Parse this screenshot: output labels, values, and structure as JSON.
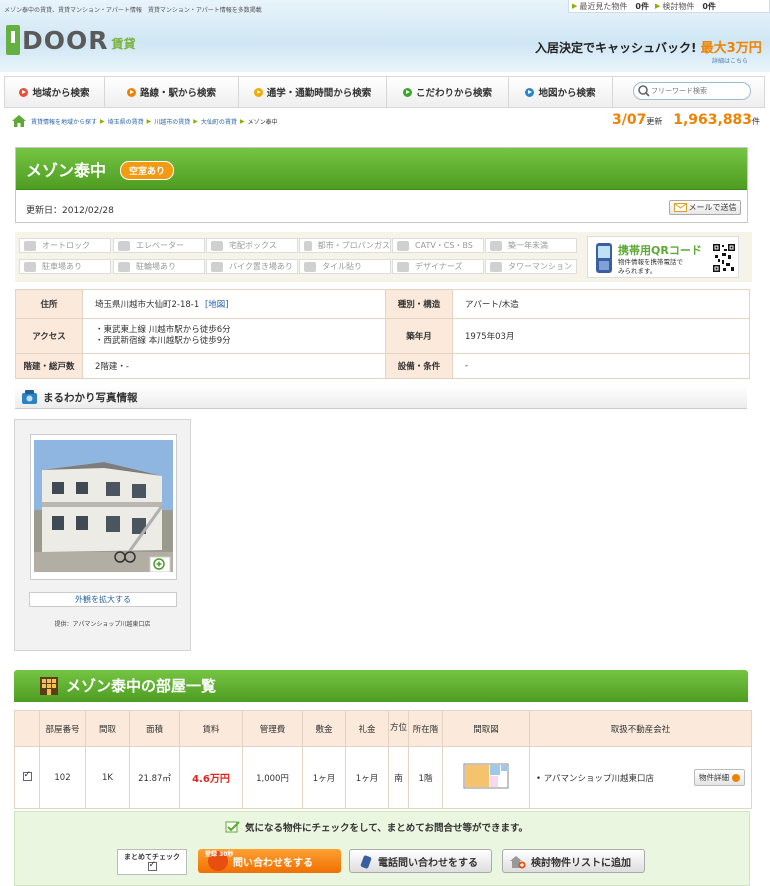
{
  "header": {
    "tagline": "メゾン泰中の賃貸、賃貸マンション・アパート情報　賃貸マンション・アパート情報を多数掲載",
    "recently_viewed_label": "最近見た物件",
    "recently_viewed_count": "0件",
    "considering_label": "検討物件",
    "considering_count": "0件",
    "logo_text": "DOOR",
    "logo_sub": "賃貸",
    "cashback_text": "入居決定でキャッシュバック!",
    "cashback_max": "最大3万円",
    "details_link": "詳細はこちら"
  },
  "nav": {
    "items": [
      {
        "label": "地域から検索",
        "color": "#e84e3a"
      },
      {
        "label": "路線・駅から検索",
        "color": "#ef8200"
      },
      {
        "label": "通学・通勤時間から検索",
        "color": "#f2a900"
      },
      {
        "label": "こだわりから検索",
        "color": "#3aa62a"
      },
      {
        "label": "地図から検索",
        "color": "#2a86c8"
      }
    ],
    "search_placeholder": "フリーワード検索"
  },
  "breadcrumb": [
    "賃貸情報を地域から探す",
    "埼玉県の賃貸",
    "川越市の賃貸",
    "大仙町の賃貸",
    "メゾン泰中"
  ],
  "update": {
    "date": "3/07",
    "date_suffix": "更新",
    "count": "1,963,883",
    "count_suffix": "件"
  },
  "property": {
    "name": "メゾン泰中",
    "vacancy": "空室あり",
    "updated": "更新日：2012/02/28",
    "mail_button": "メールで送信"
  },
  "features": [
    "オートロック",
    "エレベーター",
    "宅配ボックス",
    "都市・プロパンガス",
    "CATV・CS・BS",
    "築一年未満",
    "駐車場あり",
    "駐輪場あり",
    "バイク置き場あり",
    "タイル貼り",
    "デザイナーズ",
    "タワーマンション"
  ],
  "qr": {
    "title": "携帯用QRコード",
    "desc": "物件情報を携帯電話で\nみられます。"
  },
  "details": {
    "address_label": "住所",
    "address": "埼玉県川越市大仙町2-18-1",
    "map_link": "[地図]",
    "type_label": "種別・構造",
    "type": "アパート/木造",
    "access_label": "アクセス",
    "access_1": "・東武東上線 川越市駅から徒歩6分",
    "access_2": "・西武新宿線 本川越駅から徒歩9分",
    "built_label": "築年月",
    "built": "1975年03月",
    "floors_label": "階建・総戸数",
    "floors": "2階建・-",
    "facilities_label": "設備・条件",
    "facilities": "-"
  },
  "photo": {
    "title": "まるわかり写真情報",
    "enlarge": "外観を拡大する",
    "provider": "提供：アパマンショップ川越東口店"
  },
  "rooms": {
    "title": "メゾン泰中の部屋一覧",
    "headers": [
      "部屋番号",
      "間取",
      "面積",
      "賃料",
      "管理費",
      "敷金",
      "礼金",
      "方位",
      "所在階",
      "間取図",
      "取扱不動産会社"
    ],
    "row": {
      "room": "102",
      "layout": "1K",
      "area": "21.87㎡",
      "rent": "4.6万円",
      "fee": "1,000円",
      "deposit": "1ヶ月",
      "key": "1ヶ月",
      "direction": "南",
      "floor": "1階",
      "agent": "アパマンショップ川越東口店",
      "detail": "物件詳細"
    }
  },
  "actions": {
    "message": "気になる物件にチェックをして、まとめてお問合せ等ができます。",
    "bulk_check": "まとめてチェック",
    "badge": "登録 30秒",
    "inquiry": "問い合わせをする",
    "phone": "電話問い合わせをする",
    "list": "検討物件リストに追加"
  }
}
